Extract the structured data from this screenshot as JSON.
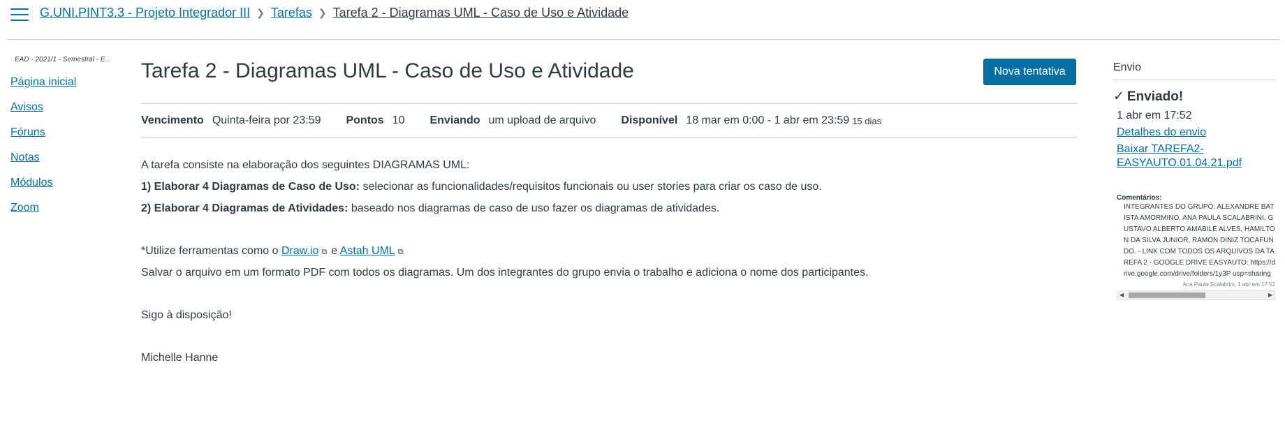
{
  "breadcrumb": {
    "course": "G.UNI.PINT3.3 - Projeto Integrador III",
    "section": "Tarefas",
    "current": "Tarefa 2 - Diagramas UML - Caso de Uso e Atividade"
  },
  "left_nav": {
    "term": "EAD - 2021/1 - Semestral - E...",
    "items": [
      "Página inicial",
      "Avisos",
      "Fóruns",
      "Notas",
      "Módulos",
      "Zoom"
    ]
  },
  "assignment": {
    "title": "Tarefa 2 - Diagramas UML - Caso de Uso e Atividade",
    "new_attempt_label": "Nova tentativa",
    "meta": {
      "due_label": "Vencimento",
      "due_value": "Quinta-feira por 23:59",
      "points_label": "Pontos",
      "points_value": "10",
      "submitting_label": "Enviando",
      "submitting_value": "um upload de arquivo",
      "available_label": "Disponível",
      "available_value": "18 mar em 0:00 - 1 abr em 23:59",
      "available_days": "15 dias"
    },
    "description": {
      "intro": "A tarefa consiste na elaboração dos seguintes DIAGRAMAS UML:",
      "item1_bold": "1) Elaborar 4 Diagramas de Caso de Uso:",
      "item1_text": " selecionar as funcionalidades/requisitos funcionais ou user stories para criar os caso de uso.",
      "item2_bold": "2) Elaborar 4 Diagramas de Atividades:",
      "item2_text": " baseado nos diagramas de caso de uso fazer os diagramas de atividades.",
      "tools_prefix": "*Utilize ferramentas como o ",
      "tool1": "Draw.io",
      "tools_and": "e ",
      "tool2": "Astah UML",
      "save_text": "Salvar o arquivo em um formato PDF com todos os diagramas. Um dos integrantes do grupo envia o trabalho e adiciona o nome dos participantes.",
      "closing": "Sigo à disposição!",
      "signature": "Michelle Hanne"
    }
  },
  "submission": {
    "heading": "Envio",
    "status": "Enviado!",
    "date": "1 abr em 17:52",
    "details_link": "Detalhes do envio",
    "download_link": "Baixar TAREFA2-EASYAUTO.01.04.21.pdf",
    "comments_label": "Comentários:",
    "comment_text": "INTEGRANTES DO GRUPO: ALEXANDRE BATISTA AMORMINO, ANA PAULA SCALABRINI, GUSTAVO ALBERTO AMABILE ALVES, HAMILTON DA SILVA JUNIOR, RAMON DINIZ TOCAFUNDO. - LINK COM TODOS OS ARQUIVOS DA TAREFA 2 - GOOGLE DRIVE EASYAUTO: https://drive.google.com/drive/folders/1y3P usp=sharing",
    "comment_author": "Ana Paula Scalabrini, 1 abr em 17:52"
  },
  "icons": {
    "menu": "hamburger-icon",
    "separator": "chevron-right-icon",
    "check": "check-icon",
    "external": "external-link-icon"
  }
}
